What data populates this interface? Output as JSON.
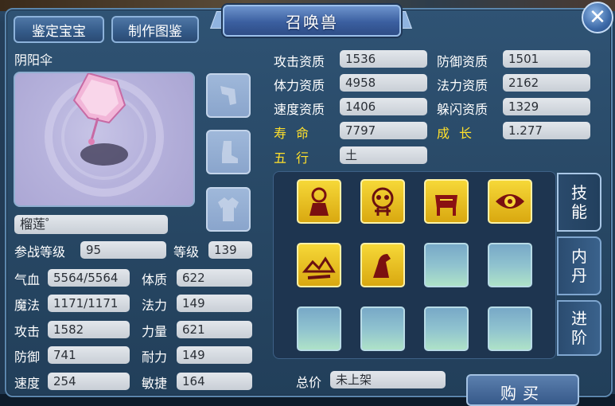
{
  "window": {
    "title": "召唤兽",
    "close_label": "✕"
  },
  "buttons": {
    "appraise": "鉴定宝宝",
    "catalog": "制作图鉴",
    "buy": "购买"
  },
  "pet": {
    "species": "阴阳伞",
    "name": "榴莲゜"
  },
  "left_stats": [
    {
      "label": "参战等级",
      "value": "95"
    },
    {
      "label": "等级",
      "value": "139"
    },
    {
      "label": "气血",
      "value": "5564/5564"
    },
    {
      "label": "体质",
      "value": "622"
    },
    {
      "label": "魔法",
      "value": "1171/1171"
    },
    {
      "label": "法力",
      "value": "149"
    },
    {
      "label": "攻击",
      "value": "1582"
    },
    {
      "label": "力量",
      "value": "621"
    },
    {
      "label": "防御",
      "value": "741"
    },
    {
      "label": "耐力",
      "value": "149"
    },
    {
      "label": "速度",
      "value": "254"
    },
    {
      "label": "敏捷",
      "value": "164"
    }
  ],
  "aptitudes": [
    {
      "label": "攻击资质",
      "value": "1536"
    },
    {
      "label": "防御资质",
      "value": "1501"
    },
    {
      "label": "体力资质",
      "value": "4958"
    },
    {
      "label": "法力资质",
      "value": "2162"
    },
    {
      "label": "速度资质",
      "value": "1406"
    },
    {
      "label": "躲闪资质",
      "value": "1329"
    },
    {
      "label": "寿命",
      "value": "7797"
    },
    {
      "label": "成长",
      "value": "1.277"
    },
    {
      "label": "五行",
      "value": "土"
    }
  ],
  "price": {
    "label": "总价",
    "value": "未上架"
  },
  "tabs": [
    "技能",
    "内丹",
    "进阶"
  ],
  "equipment_icons": [
    "helmet-icon",
    "boots-icon",
    "armor-icon"
  ],
  "skills": [
    "skill-icon-1",
    "skill-icon-2",
    "skill-icon-3",
    "skill-icon-4",
    "skill-icon-5",
    "skill-icon-6"
  ],
  "colors": {
    "accent_gold": "#ffe02b",
    "panel": "#284865",
    "skill_gold": "#e8c020"
  }
}
